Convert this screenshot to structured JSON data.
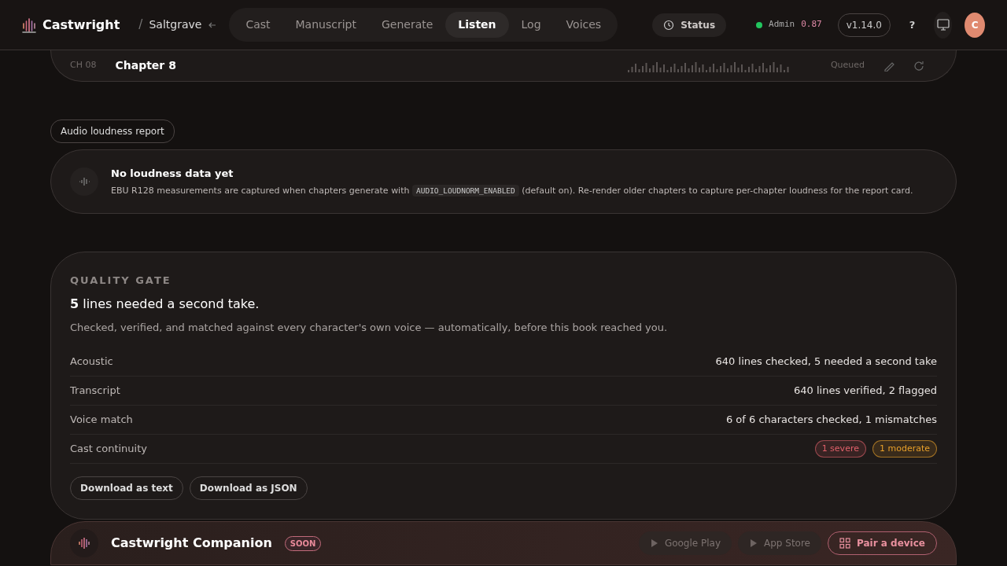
{
  "brand": {
    "name": "Castwright",
    "separator": "/",
    "project": "Saltgrave"
  },
  "nav_tabs": [
    {
      "label": "Cast",
      "selected": false
    },
    {
      "label": "Manuscript",
      "selected": false
    },
    {
      "label": "Generate",
      "selected": false
    },
    {
      "label": "Listen",
      "selected": true
    },
    {
      "label": "Log",
      "selected": false
    },
    {
      "label": "Voices",
      "selected": false
    }
  ],
  "status_button": "Status",
  "admin": {
    "label": "Admin",
    "value": "0.87",
    "online": true
  },
  "version": "v1.14.0",
  "help": "?",
  "avatar": "C",
  "chapter_row": {
    "number": "CH 08",
    "title": "Chapter 8",
    "state": "Queued"
  },
  "loudness": {
    "chip": "Audio loudness report",
    "title": "No loudness data yet",
    "text_before": "EBU R128 measurements are captured when chapters generate with",
    "code": "AUDIO_LOUDNORM_ENABLED",
    "text_after": "(default on). Re-render older chapters to capture per-chapter loudness for the report card."
  },
  "quality_gate": {
    "eyebrow": "QUALITY GATE",
    "headline": "**5** lines needed a second take.",
    "subtitle": "Checked, verified, and matched against every character's own voice — automatically, before this book reached you.",
    "rows": [
      {
        "label": "Acoustic",
        "kind": "text",
        "value": "640 lines checked, 5 needed a second take"
      },
      {
        "label": "Transcript",
        "kind": "text",
        "value": "640 lines verified, 2 flagged"
      },
      {
        "label": "Voice match",
        "kind": "text",
        "value": "6 of 6 characters checked, 1 mismatches"
      },
      {
        "label": "Cast continuity",
        "kind": "badges",
        "badges": [
          {
            "text": "1 severe",
            "color": "#e0606a"
          },
          {
            "text": "1 moderate",
            "color": "#e8a02a"
          }
        ]
      }
    ],
    "buttons": [
      "Download as text",
      "Download as JSON"
    ]
  },
  "companion": {
    "title": "Castwright Companion",
    "badge": "SOON",
    "buttons": [
      {
        "label": "Google Play",
        "kind": "store"
      },
      {
        "label": "App Store",
        "kind": "store"
      },
      {
        "label": "Pair a device",
        "kind": "pair"
      }
    ]
  }
}
